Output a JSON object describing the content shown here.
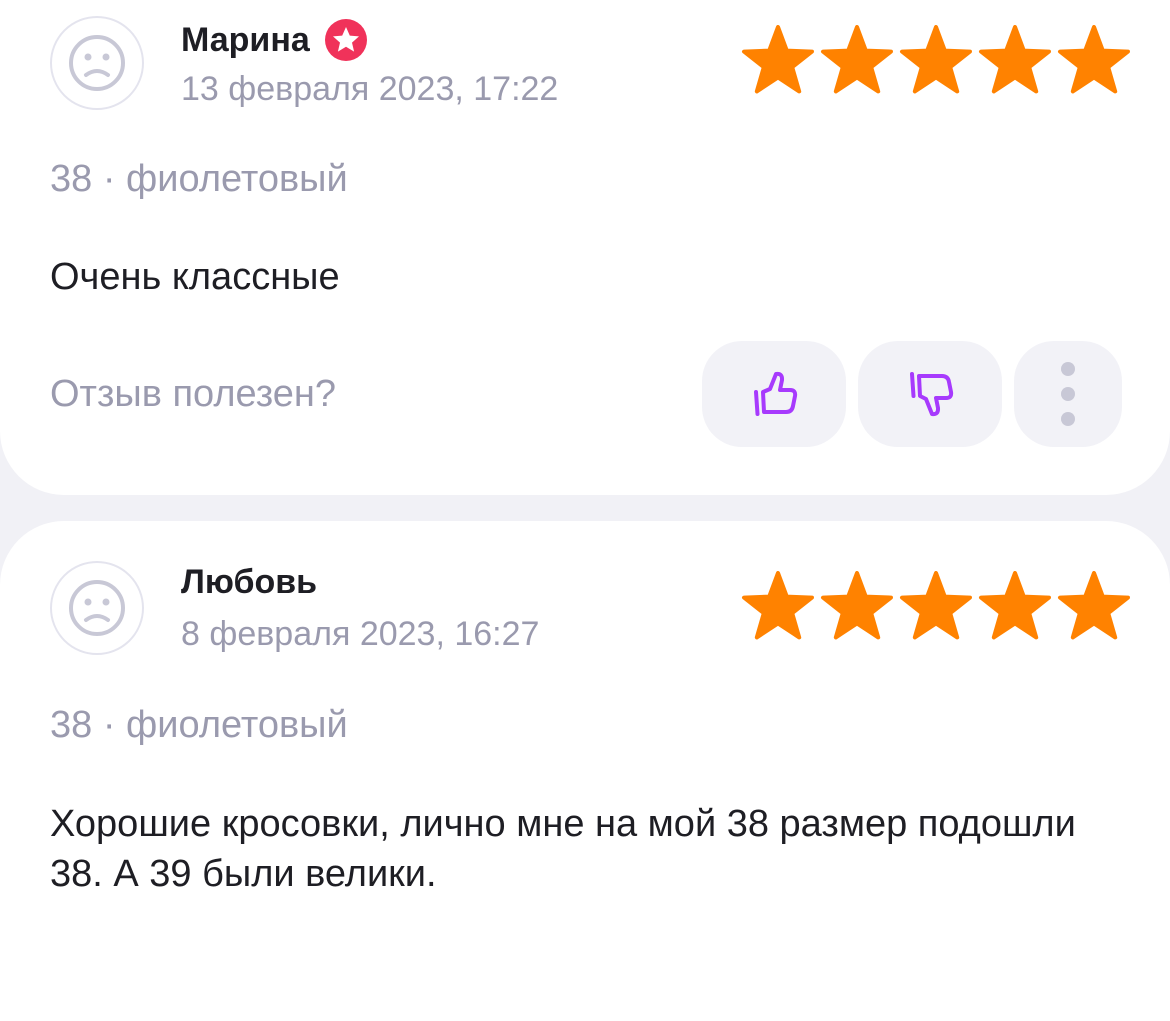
{
  "reviews": [
    {
      "author": "Марина",
      "has_badge": true,
      "date": "13 февраля 2023, 17:22",
      "rating": 5,
      "variant": "38 · фиолетовый",
      "text": "Очень классные",
      "helpful_prompt": "Отзыв полезен?"
    },
    {
      "author": "Любовь",
      "has_badge": false,
      "date": "8 февраля 2023, 16:27",
      "rating": 5,
      "variant": "38 · фиолетовый",
      "text": "Хорошие кросовки, лично мне на мой 38 размер подошли 38. А 39 были велики."
    }
  ],
  "icons": {
    "avatar": "sad-face-icon",
    "badge": "star-badge-icon",
    "like": "thumbs-up-icon",
    "dislike": "thumbs-down-icon",
    "more": "more-vertical-icon"
  },
  "colors": {
    "star": "#ff8200",
    "accent": "#a73afd",
    "badge": "#f0325a",
    "muted_text": "#9a9aae",
    "page_background": "#f1f1f6"
  }
}
